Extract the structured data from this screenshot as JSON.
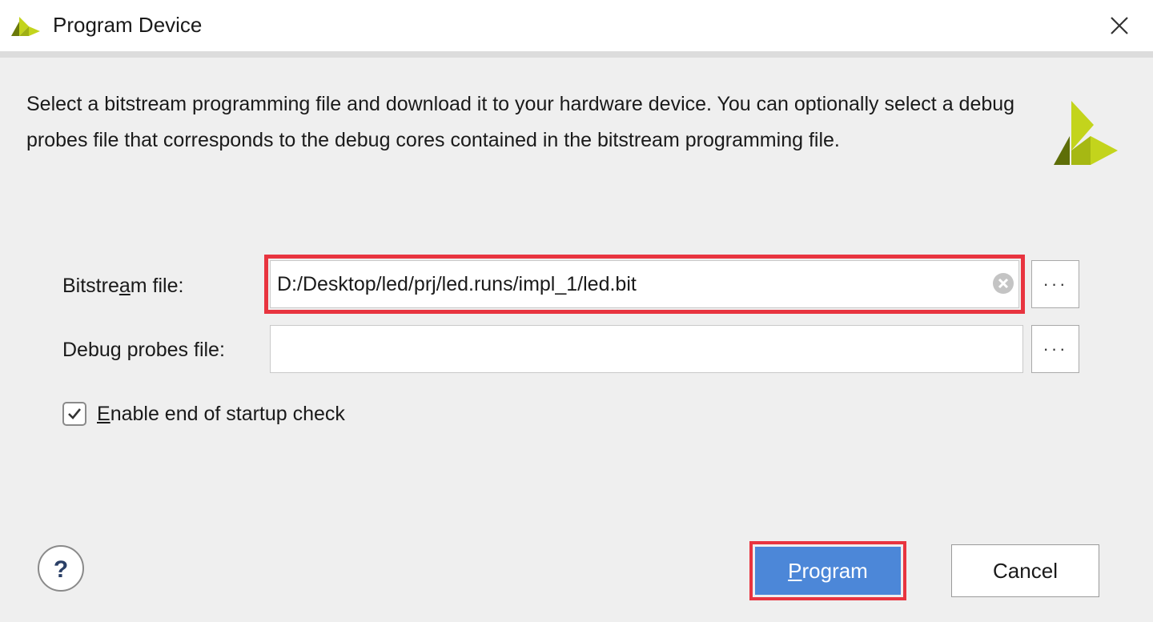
{
  "window": {
    "title": "Program Device",
    "close_icon": "close-icon",
    "app_icon": "xilinx-logo-icon"
  },
  "description": "Select a bitstream programming file and download it to your hardware device. You can optionally select a debug probes file that corresponds to the debug cores contained in the bitstream programming file.",
  "bitstream": {
    "label_pre": "Bitstre",
    "label_mnemonic": "a",
    "label_post": "m file:",
    "value": "D:/Desktop/led/prj/led.runs/impl_1/led.bit",
    "browse_label": "···"
  },
  "debug_probes": {
    "label_pre": "Debu",
    "label_mnemonic": "g",
    "label_post": " probes file:",
    "value": "",
    "browse_label": "···"
  },
  "startup_check": {
    "label_mnemonic": "E",
    "label_post": "nable end of startup check",
    "checked": true
  },
  "buttons": {
    "help_label": "?",
    "program_mnemonic": "P",
    "program_post": "rogram",
    "cancel": "Cancel"
  },
  "colors": {
    "accent": "#4c87d8",
    "highlight": "#e8343f",
    "logo_light": "#c3d41c",
    "logo_dark": "#5e6e08"
  }
}
